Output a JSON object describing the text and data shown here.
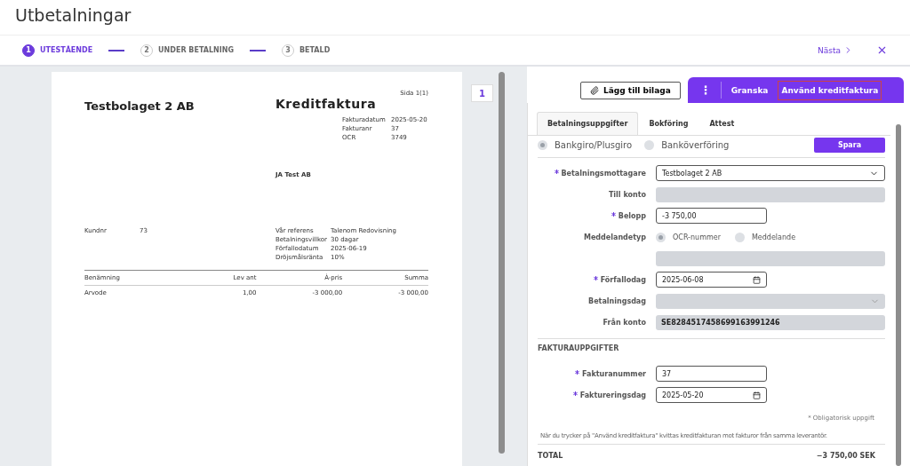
{
  "title": "Utbetalningar",
  "steps": [
    {
      "number": "1",
      "label": "UTESTÅENDE",
      "selected": true
    },
    {
      "number": "2",
      "label": "UNDER BETALNING",
      "selected": false
    },
    {
      "number": "3",
      "label": "BETALD",
      "selected": false
    }
  ],
  "next_link": "Nästa",
  "document": {
    "company": "Testbolaget 2 AB",
    "page": "Sida 1(1)",
    "doc_title": "Kreditfaktura",
    "meta": [
      [
        "Fakturadatum",
        "2025-05-20"
      ],
      [
        "Fakturanr",
        "37"
      ],
      [
        "OCR",
        "3749"
      ]
    ],
    "recipient": "JA Test AB",
    "customer": [
      "Kundnr",
      "73"
    ],
    "terms": [
      [
        "Vår referens",
        "Talenom Redovisning"
      ],
      [
        "Betalningsvillkor",
        "30 dagar"
      ],
      [
        "Förfallodatum",
        "2025-06-19"
      ],
      [
        "Dröjsmålsränta",
        "10%"
      ]
    ],
    "columns": [
      "Benämning",
      "Lev ant",
      "À-pris",
      "Summa"
    ],
    "rows": [
      [
        "Arvode",
        "1,00",
        "-3 000,00",
        "-3 000,00"
      ]
    ]
  },
  "page_number": "1",
  "attach_button": "Lägg till bilaga",
  "actions": [
    {
      "kind": "menu",
      "label": "⋮"
    },
    {
      "kind": "button",
      "label": "Granska"
    },
    {
      "kind": "button",
      "label": "Använd kreditfaktura"
    }
  ],
  "tabs": [
    {
      "label": "Betalningsuppgifter",
      "selected": true
    },
    {
      "label": "Bokföring",
      "selected": false
    },
    {
      "label": "Attest",
      "selected": false
    }
  ],
  "payment_types": [
    {
      "label": "Bankgiro/Plusgiro",
      "selected": true
    },
    {
      "label": "Banköverföring",
      "selected": false
    }
  ],
  "save_button": "Spara",
  "fields": [
    {
      "label": "Betalningsmottagare",
      "required": true,
      "kind": "select",
      "value": "Testbolaget 2 AB"
    },
    {
      "label": "Till konto",
      "required": false,
      "kind": "readonly"
    },
    {
      "label": "Belopp",
      "required": true,
      "kind": "input",
      "value": "-3 750,00"
    },
    {
      "label": "Meddelandetyp",
      "required": false,
      "kind": "radio",
      "options": [
        {
          "label": "OCR-nummer",
          "selected": true
        },
        {
          "label": "Meddelande",
          "selected": false
        }
      ]
    },
    {
      "required": false,
      "kind": "readonly"
    },
    {
      "label": "Förfallodag",
      "required": true,
      "kind": "date",
      "value": "2025-06-08"
    },
    {
      "label": "Betalningsdag",
      "required": false,
      "kind": "readonly-select"
    },
    {
      "label": "Från konto",
      "required": false,
      "kind": "readonly",
      "value": "SE8284517458699163991246"
    }
  ],
  "invoice_section": {
    "heading": "FAKTURAUPPGIFTER",
    "fields": [
      {
        "label": "Fakturanummer",
        "required": true,
        "kind": "input",
        "value": "37"
      },
      {
        "label": "Faktureringsdag",
        "required": true,
        "kind": "date",
        "value": "2025-05-20"
      }
    ]
  },
  "required_note": "* Obligatorisk uppgift",
  "info_text": "När du trycker på \"Använd kreditfaktura\" kvittas kreditfakturan mot fakturor från samma leverantör.",
  "total": {
    "label": "TOTAL",
    "value": "−3 750,00 SEK"
  }
}
